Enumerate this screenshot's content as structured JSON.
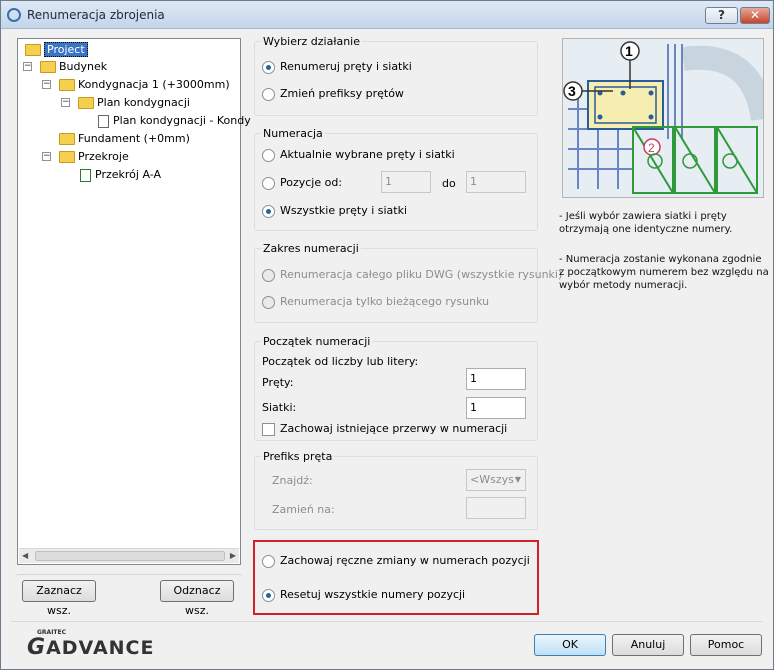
{
  "window": {
    "title": "Renumeracja zbrojenia",
    "help_label": "?",
    "close_label": "✕"
  },
  "tree": {
    "project": "Project",
    "budynek": "Budynek",
    "kondygnacja": "Kondygnacja 1 (+3000mm)",
    "plan": "Plan kondygnacji",
    "plan_doc": "Plan kondygnacji - Kondy",
    "fundament": "Fundament (+0mm)",
    "przekroje": "Przekroje",
    "przekroj": "Przekrój A-A"
  },
  "left_buttons": {
    "select_all": "Zaznacz wsz.",
    "deselect_all": "Odznacz wsz."
  },
  "action": {
    "title": "Wybierz działanie",
    "renumber": "Renumeruj pręty i siatki",
    "change_prefix": "Zmień prefiksy prętów"
  },
  "numbering": {
    "title": "Numeracja",
    "selected": "Aktualnie wybrane pręty i siatki",
    "positions_from": "Pozycje od:",
    "from_value": "1",
    "to_label": "do",
    "to_value": "1",
    "all": "Wszystkie pręty i siatki"
  },
  "range": {
    "title": "Zakres numeracji",
    "whole_file": "Renumeracja całego pliku DWG (wszystkie rysunki)",
    "current_only": "Renumeracja tylko bieżącego rysunku"
  },
  "start": {
    "title": "Początek numeracji",
    "from_label": "Początek od liczby lub litery:",
    "bars_label": "Pręty:",
    "bars_value": "1",
    "mesh_label": "Siatki:",
    "mesh_value": "1",
    "keep_gaps": "Zachowaj istniejące przerwy w numeracji"
  },
  "prefix": {
    "title": "Prefiks pręta",
    "find_label": "Znajdź:",
    "find_value": "<Wszys",
    "replace_label": "Zamień na:"
  },
  "manual": {
    "keep": "Zachowaj ręczne zmiany w numerach pozycji",
    "reset": "Resetuj wszystkie numery pozycji"
  },
  "info": {
    "line1": "- Jeśli wybór zawiera siatki i pręty otrzymają one identyczne numery.",
    "line2": "- Numeracja zostanie wykonana zgodnie z początkowym numerem bez względu na wybór metody numeracji."
  },
  "illustration": {
    "callout1": "1",
    "callout2": "2",
    "callout3": "3"
  },
  "logo": {
    "small": "GRAITEC",
    "main": "ADVANCE",
    "letter": "G"
  },
  "footer": {
    "ok": "OK",
    "cancel": "Anuluj",
    "help": "Pomoc"
  }
}
